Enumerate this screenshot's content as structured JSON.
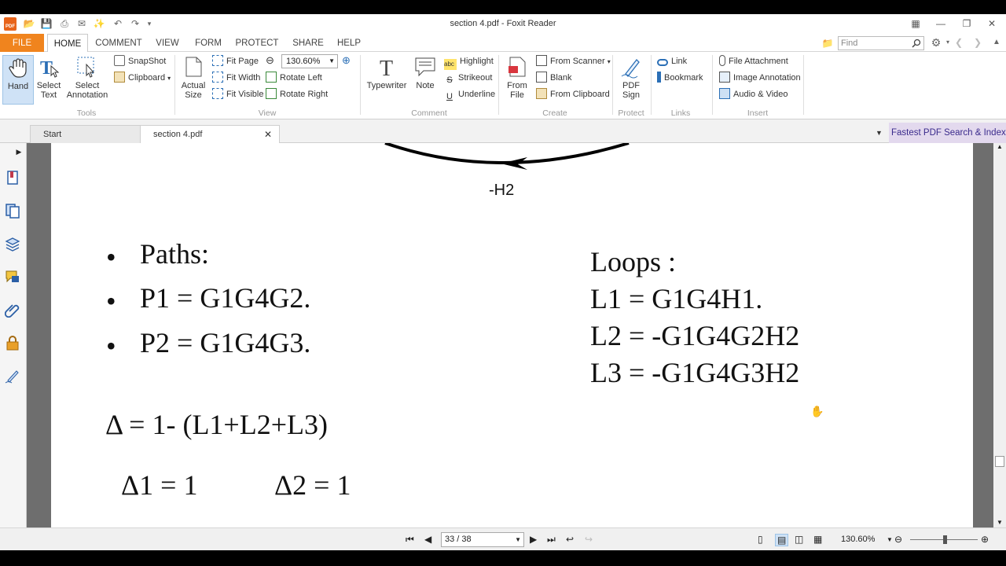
{
  "window": {
    "title": "section 4.pdf - Foxit Reader",
    "logo_text": "PDF"
  },
  "menu": {
    "tabs": [
      "FILE",
      "HOME",
      "COMMENT",
      "VIEW",
      "FORM",
      "PROTECT",
      "SHARE",
      "HELP"
    ],
    "active": "HOME",
    "find_placeholder": "Find"
  },
  "ribbon": {
    "tools": {
      "label": "Tools",
      "hand": "Hand",
      "select_text": "Select\nText",
      "select_annotation": "Select\nAnnotation",
      "snapshot": "SnapShot",
      "clipboard": "Clipboard"
    },
    "view": {
      "label": "View",
      "actual_size": "Actual\nSize",
      "fit_page": "Fit Page",
      "fit_width": "Fit Width",
      "fit_visible": "Fit Visible",
      "zoom": "130.60%",
      "rotate_left": "Rotate Left",
      "rotate_right": "Rotate Right"
    },
    "comment": {
      "label": "Comment",
      "typewriter": "Typewriter",
      "note": "Note",
      "highlight": "Highlight",
      "strikeout": "Strikeout",
      "underline": "Underline"
    },
    "create": {
      "label": "Create",
      "from_file": "From\nFile",
      "from_scanner": "From Scanner",
      "blank": "Blank",
      "from_clipboard": "From Clipboard"
    },
    "protect": {
      "label": "Protect",
      "pdf_sign": "PDF\nSign"
    },
    "links": {
      "label": "Links",
      "link": "Link",
      "bookmark": "Bookmark"
    },
    "insert": {
      "label": "Insert",
      "file_attachment": "File Attachment",
      "image_annotation": "Image Annotation",
      "audio_video": "Audio & Video"
    }
  },
  "doc_tabs": {
    "start": "Start",
    "current": "section 4.pdf",
    "ad": "Fastest PDF Search & Index"
  },
  "document": {
    "arrow_label": "-H2",
    "paths_header": "Paths:",
    "p1": "P1 = G1G4G2.",
    "p2": "P2 = G1G4G3.",
    "loops_header": "Loops :",
    "l1": "L1 = G1G4H1.",
    "l2": "L2 = -G1G4G2H2",
    "l3": "L3 = -G1G4G3H2",
    "delta": "Δ = 1- (L1+L2+L3)",
    "delta1": "Δ1 = 1",
    "delta2": "Δ2 = 1"
  },
  "status": {
    "page": "33 / 38",
    "zoom": "130.60%"
  }
}
